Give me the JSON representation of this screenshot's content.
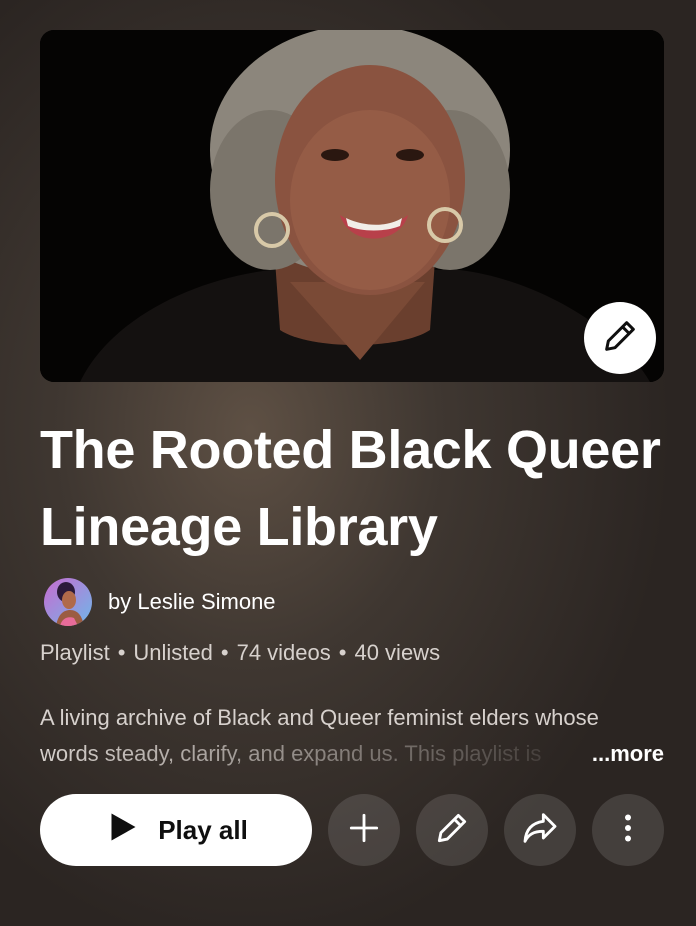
{
  "playlist": {
    "title": "The Rooted Black Queer Lineage Library",
    "owner": "by Leslie Simone",
    "meta": {
      "type": "Playlist",
      "visibility": "Unlisted",
      "videos": "74 videos",
      "views": "40 views",
      "separator": "•"
    },
    "description": {
      "line1": "A living archive of Black and Queer feminist elders whose",
      "line2": "words steady, clarify, and expand us. This playlist is",
      "more_label": "...more"
    }
  },
  "thumbnail": {
    "edit_icon": "pencil-icon"
  },
  "actions": {
    "play_all_label": "Play all",
    "icons": [
      "play-icon",
      "plus-icon",
      "pencil-icon",
      "share-icon",
      "more-vertical-icon"
    ]
  },
  "colors": {
    "background": "#3f3731",
    "text_secondary": "#d7d1cd",
    "button_bg": "#ffffff"
  }
}
